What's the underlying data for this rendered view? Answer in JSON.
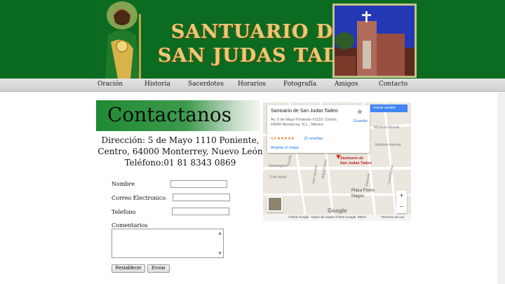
{
  "banner": {
    "title_line1": "SANTUARIO DE",
    "title_line2": "SAN JUDAS TADEO"
  },
  "nav": {
    "items": [
      {
        "label": "Oración"
      },
      {
        "label": "Historia"
      },
      {
        "label": "Sacerdotes"
      },
      {
        "label": "Horarios"
      },
      {
        "label": "Fotografía"
      },
      {
        "label": "Amigos"
      },
      {
        "label": "Contacto"
      }
    ]
  },
  "contact": {
    "heading": "Contactanos",
    "address_line1": "Dirección: 5 de Mayo 1110 Poniente,",
    "address_line2": "Centro, 64000 Monterrey, Nuevo León",
    "phone": "Teléfono:01 81 8343 0869",
    "form": {
      "name_label": "Nombre",
      "email_label": "Correo Electronico",
      "phone_label": "Telefono",
      "comments_label": "Comentarios",
      "reset_label": "Restablecer",
      "submit_label": "Enviar"
    }
  },
  "map": {
    "place_name": "Santuario de San Judas Tadeo",
    "place_address": "Av. 5 de Mayo Poniente #1110, Centro, 64000 Monterrey, N.L., México",
    "rating": "4,8 ★★★★★",
    "reviews": "21 reseñas",
    "larger_map": "Ampliar el mapa",
    "save": "Guardar",
    "signin": "Iniciar sesión",
    "pin_label_line1": "Santuario de",
    "pin_label_line2": "San Judas Tadeo",
    "poi_line1": "Plaza Flores",
    "poi_line2": "Magon",
    "road_labels": [
      "Modesto Arreola",
      "Modesto Arreola",
      "5 de Mayo",
      "Washington",
      "Treviño",
      "Juan Ignacio",
      "Miguel Nieto",
      "Galeana",
      "Cuauhtémoc"
    ],
    "google": "Google",
    "copyright": "©2016 Google · Datos de mapas ©2016 Google, INEGI",
    "terms": "Términos de uso",
    "zoom_in": "+",
    "zoom_out": "−"
  }
}
